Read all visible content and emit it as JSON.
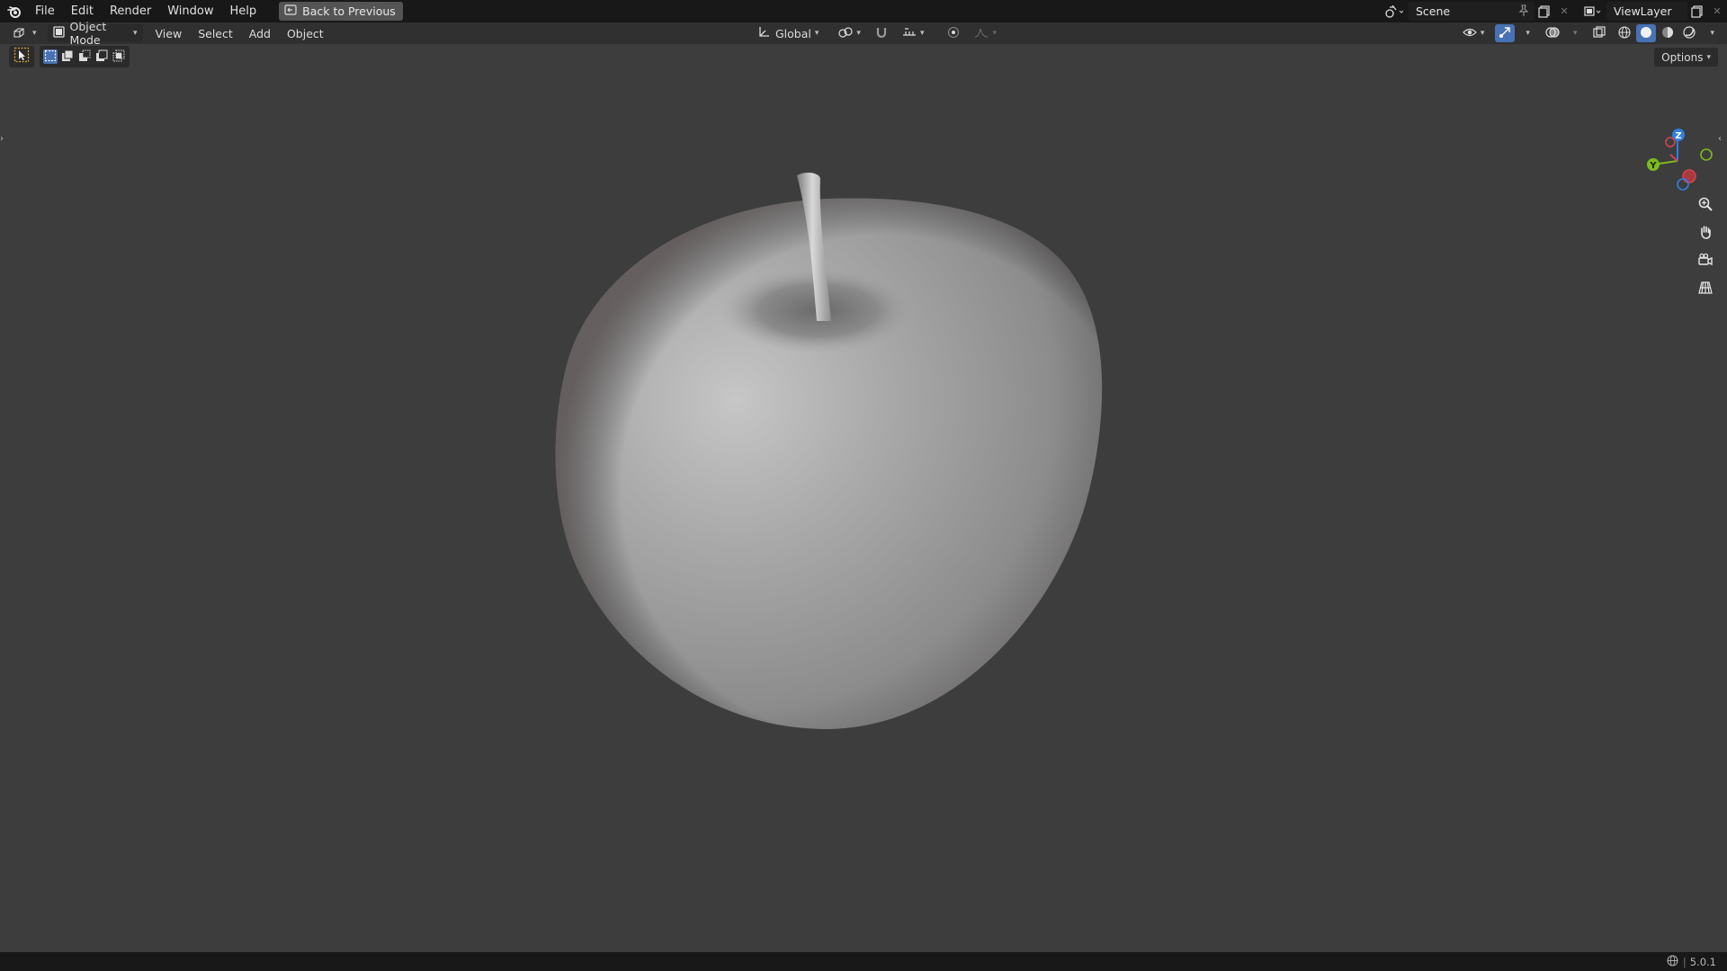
{
  "topbar": {
    "logo_icon": "blender-logo-icon",
    "menus": [
      "File",
      "Edit",
      "Render",
      "Window",
      "Help"
    ],
    "back_button": "Back to Previous",
    "scene_name": "Scene",
    "view_layer": "ViewLayer"
  },
  "header": {
    "editor_type_icon": "3d-viewport-icon",
    "mode": "Object Mode",
    "menus": [
      "View",
      "Select",
      "Add",
      "Object"
    ],
    "transform_orientation": "Global",
    "options_label": "Options"
  },
  "gizmo": {
    "x_label": "",
    "y_label": "Y",
    "z_label": "Z",
    "x_color": "#d9434e",
    "y_color": "#7bbb1e",
    "z_color": "#2f7fe0"
  },
  "status": {
    "version": "5.0.1"
  },
  "colors": {
    "viewport_bg": "#3d3d3d",
    "topbar_bg": "#181818",
    "header_bg": "#303030",
    "accent": "#4772b3"
  }
}
